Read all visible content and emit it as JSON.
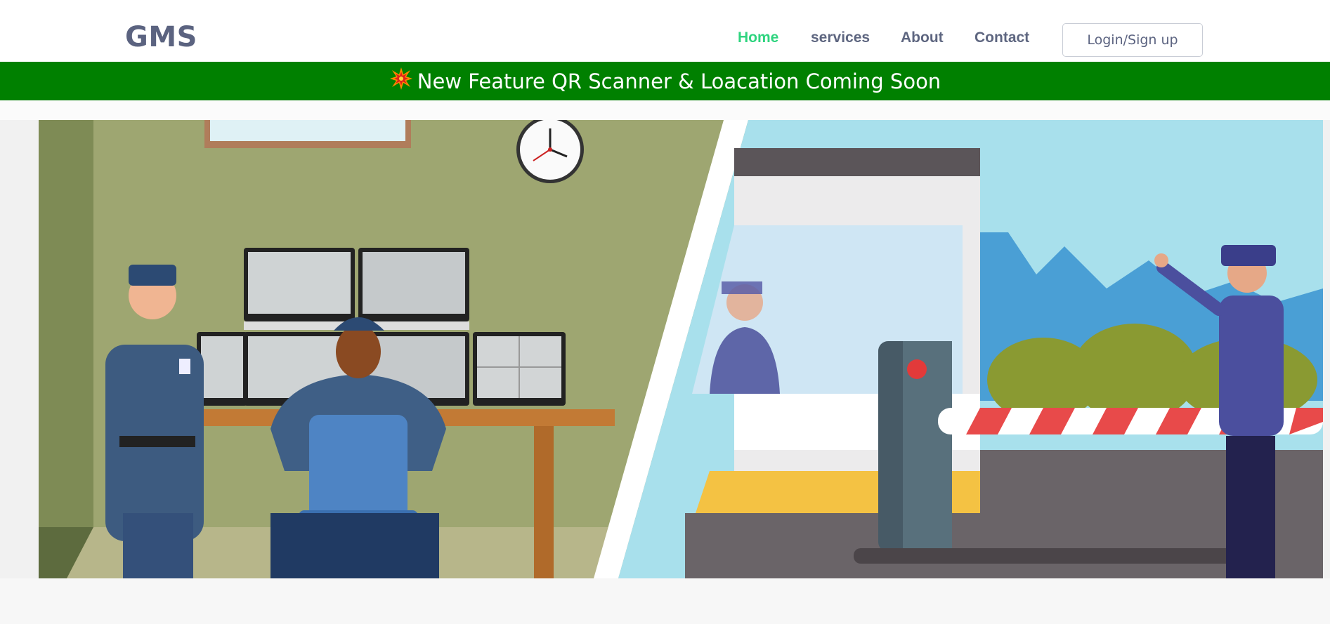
{
  "brand": {
    "name": "GMS"
  },
  "nav": {
    "items": [
      {
        "label": "Home",
        "active": true
      },
      {
        "label": "services",
        "active": false
      },
      {
        "label": "About",
        "active": false
      },
      {
        "label": "Contact",
        "active": false
      }
    ],
    "login_label": "Login/Sign up"
  },
  "announcement": {
    "icon": "explosion-icon",
    "text": "New Feature QR Scanner & Loacation Coming Soon"
  },
  "hero": {
    "image": "security-guards-illustration"
  },
  "colors": {
    "brand_text": "#5b6380",
    "nav_active": "#2fd47f",
    "banner_bg": "#008000",
    "banner_text": "#ffffff"
  }
}
